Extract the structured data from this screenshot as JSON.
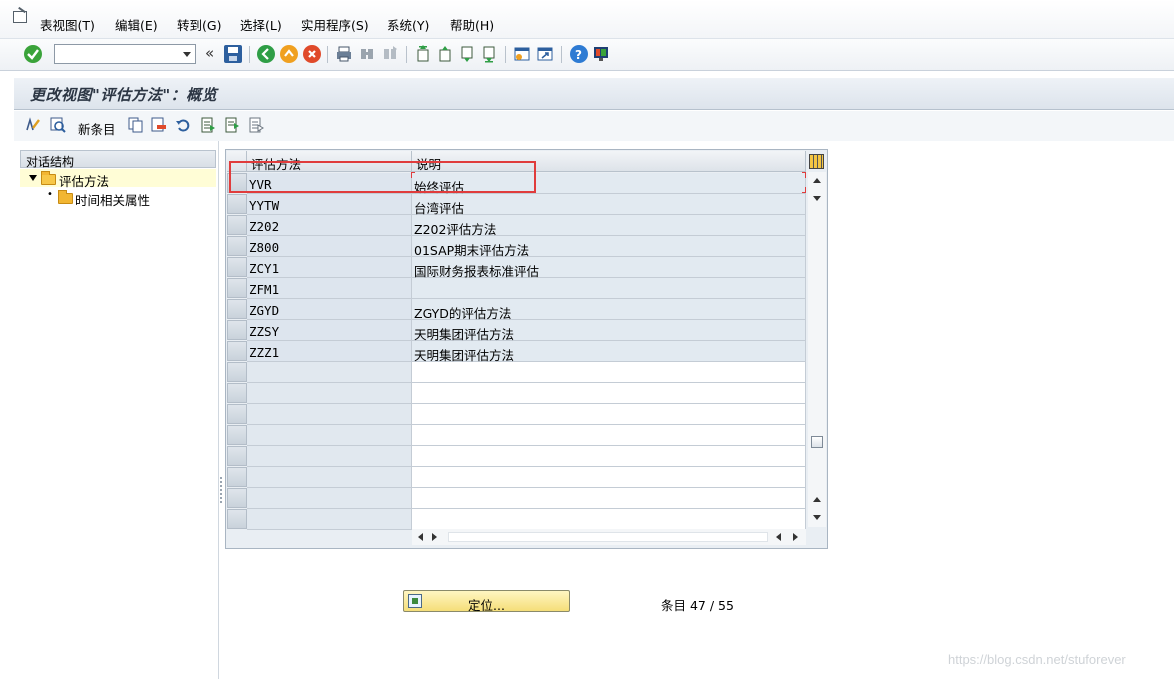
{
  "menu": {
    "items": [
      "表视图(T)",
      "编辑(E)",
      "转到(G)",
      "选择(L)",
      "实用程序(S)",
      "系统(Y)",
      "帮助(H)"
    ]
  },
  "toolbar": {
    "command_field_value": "",
    "icons": [
      "enter-icon",
      "save-icon",
      "back-icon",
      "exit-icon",
      "cancel-icon",
      "print-icon",
      "find-icon",
      "find-next-icon",
      "first-page-icon",
      "previous-page-icon",
      "next-page-icon",
      "last-page-icon",
      "create-session-icon",
      "shortcut-icon",
      "help-icon",
      "layout-icon"
    ],
    "colors": {
      "enter": "#3aa33a",
      "back": "#2f9e46",
      "exit": "#f0a020",
      "cancel": "#e04a2a",
      "help": "#2e7bd3"
    }
  },
  "title": "更改视图\"评估方法\"：概览",
  "app_toolbar": {
    "new_entries_label": "新条目",
    "icons": [
      "display-change-icon",
      "details-icon",
      "copy-icon",
      "delete-icon",
      "undo-icon",
      "select-all-icon",
      "select-block-icon",
      "deselect-all-icon"
    ]
  },
  "dialog_structure": {
    "header": "对话结构",
    "nodes": [
      {
        "label": "评估方法",
        "expanded": true,
        "selected": true
      },
      {
        "label": "时间相关属性",
        "expanded": false,
        "selected": false
      }
    ]
  },
  "table": {
    "columns": [
      "评估方法",
      "说明"
    ],
    "rows": [
      {
        "key": "YVR",
        "desc": "始终评估"
      },
      {
        "key": "YYTW",
        "desc": "台湾评估"
      },
      {
        "key": "Z202",
        "desc": "Z202评估方法"
      },
      {
        "key": "Z800",
        "desc": "01SAP期末评估方法"
      },
      {
        "key": "ZCY1",
        "desc": "国际财务报表标准评估"
      },
      {
        "key": "ZFM1",
        "desc": ""
      },
      {
        "key": "ZGYD",
        "desc": "ZGYD的评估方法"
      },
      {
        "key": "ZZSY",
        "desc": "天明集团评估方法"
      },
      {
        "key": "ZZZ1",
        "desc": "天明集团评估方法"
      }
    ],
    "empty_rows": 8
  },
  "locate_button_label": "定位...",
  "entry_count_label": "条目 47 / 55",
  "watermark": "https://blog.csdn.net/stuforever",
  "highlight_color": "#e03c3c"
}
